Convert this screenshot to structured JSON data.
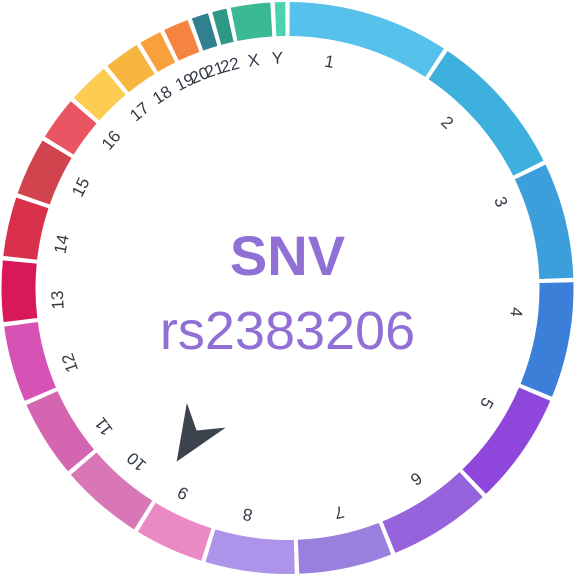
{
  "center": {
    "variant_type": "SNV",
    "variant_id": "rs2383206"
  },
  "marker": {
    "chromosome": "9",
    "color": "#3d434d"
  },
  "chromosomes": [
    {
      "label": "1",
      "color": "#56c1ea"
    },
    {
      "label": "2",
      "color": "#3eb0dd"
    },
    {
      "label": "3",
      "color": "#3c9fdc"
    },
    {
      "label": "4",
      "color": "#3b7fd8"
    },
    {
      "label": "5",
      "color": "#8f47db"
    },
    {
      "label": "6",
      "color": "#9563dc"
    },
    {
      "label": "7",
      "color": "#9a80de"
    },
    {
      "label": "8",
      "color": "#ad94ea"
    },
    {
      "label": "9",
      "color": "#ea8ac4"
    },
    {
      "label": "10",
      "color": "#d977b6"
    },
    {
      "label": "11",
      "color": "#d465b1"
    },
    {
      "label": "12",
      "color": "#d653b5"
    },
    {
      "label": "13",
      "color": "#d8185a"
    },
    {
      "label": "14",
      "color": "#d9304c"
    },
    {
      "label": "15",
      "color": "#d1444e"
    },
    {
      "label": "16",
      "color": "#ea5563"
    },
    {
      "label": "17",
      "color": "#fdcc53"
    },
    {
      "label": "18",
      "color": "#f6b640"
    },
    {
      "label": "19",
      "color": "#f8a13c"
    },
    {
      "label": "20",
      "color": "#f48440"
    },
    {
      "label": "21",
      "color": "#30808f"
    },
    {
      "label": "22",
      "color": "#2e9885"
    },
    {
      "label": "X",
      "color": "#3ab994"
    },
    {
      "label": "Y",
      "color": "#4ad3ae"
    }
  ]
}
